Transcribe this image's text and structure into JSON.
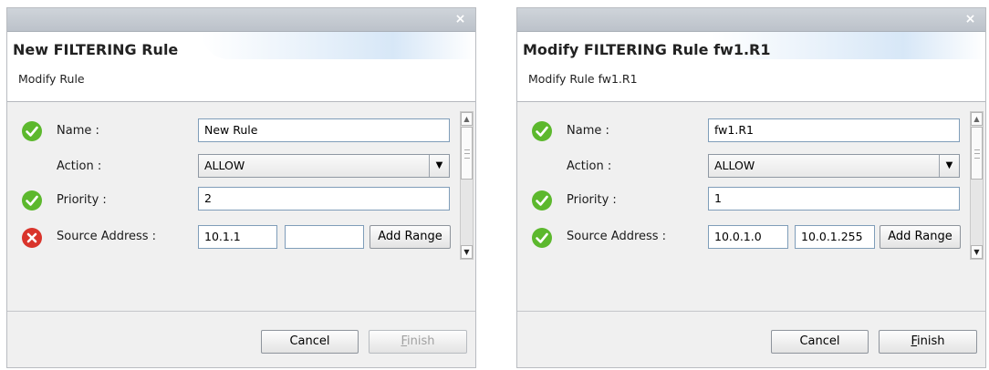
{
  "dialogs": [
    {
      "close_glyph": "×",
      "title": "New FILTERING Rule",
      "subtitle": "Modify Rule",
      "fields": {
        "name": {
          "label": "Name :",
          "value": "New Rule",
          "status": "valid"
        },
        "action": {
          "label": "Action :",
          "value": "ALLOW"
        },
        "priority": {
          "label": "Priority :",
          "value": "2",
          "status": "valid"
        },
        "source": {
          "label": "Source Address :",
          "start": "10.1.1",
          "end": "",
          "status": "invalid",
          "add_range": "Add Range"
        }
      },
      "buttons": {
        "cancel": "Cancel",
        "finish_first": "F",
        "finish_rest": "inish",
        "finish_enabled": false
      }
    },
    {
      "close_glyph": "×",
      "title": "Modify FILTERING Rule fw1.R1",
      "subtitle": "Modify Rule fw1.R1",
      "fields": {
        "name": {
          "label": "Name :",
          "value": "fw1.R1",
          "status": "valid"
        },
        "action": {
          "label": "Action :",
          "value": "ALLOW"
        },
        "priority": {
          "label": "Priority :",
          "value": "1",
          "status": "valid"
        },
        "source": {
          "label": "Source Address :",
          "start": "10.0.1.0",
          "end": "10.0.1.255",
          "status": "valid",
          "add_range": "Add Range"
        }
      },
      "buttons": {
        "cancel": "Cancel",
        "finish_first": "F",
        "finish_rest": "inish",
        "finish_enabled": true
      }
    }
  ],
  "icons": {
    "valid": "green-check-circle-icon",
    "invalid": "red-x-circle-icon",
    "dropdown": "triangle-down-icon",
    "scroll_up": "triangle-up-icon",
    "scroll_down": "triangle-down-icon"
  },
  "colors": {
    "valid": "#5cb82d",
    "invalid": "#d9342b",
    "titlebar": "#c4cad1",
    "field_border": "#7f9db9"
  }
}
